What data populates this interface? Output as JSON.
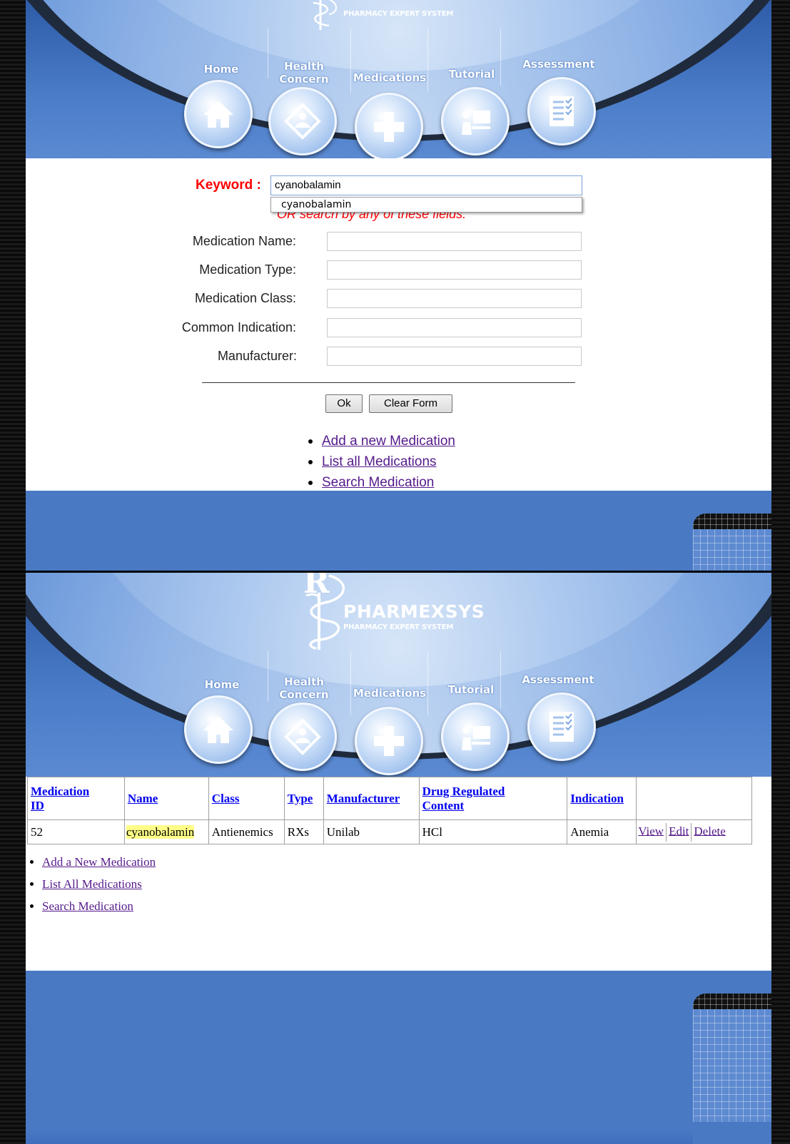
{
  "brand": {
    "name": "PHARMEXSYS",
    "subtitle": "PHARMACY EXPERT SYSTEM",
    "rx_glyph": "R"
  },
  "nav": {
    "home": "Home",
    "health_concern_line1": "Health",
    "health_concern_line2": "Concern",
    "medications": "Medications",
    "tutorial": "Tutorial",
    "assessment": "Assessment"
  },
  "search_form": {
    "keyword_label": "Keyword :",
    "keyword_value": "cyanobalamin",
    "autocomplete_suggestion": "cyanobalamin",
    "or_text": "OR search by any of these fields:",
    "fields": [
      {
        "label": "Medication Name:",
        "value": ""
      },
      {
        "label": "Medication Type:",
        "value": ""
      },
      {
        "label": "Medication Class:",
        "value": ""
      },
      {
        "label": "Common Indication:",
        "value": ""
      },
      {
        "label": "Manufacturer:",
        "value": ""
      }
    ],
    "ok_button": "Ok",
    "clear_button": "Clear Form",
    "links": [
      "Add a new Medication",
      "List all Medications",
      "Search Medication"
    ]
  },
  "results": {
    "headers": {
      "id_line1": "Medication",
      "id_line2": "ID",
      "name": "Name",
      "class": "Class",
      "type": "Type",
      "manufacturer": "Manufacturer",
      "drc_line1": "Drug Regulated",
      "drc_line2": "Content",
      "indication": "Indication"
    },
    "rows": [
      {
        "id": "52",
        "name": "cyanobalamin",
        "class": "Antienemics",
        "type": "RXs",
        "manufacturer": "Unilab",
        "drug_regulated_content": "HCl",
        "indication": "Anemia",
        "view": "View",
        "edit": "Edit",
        "delete": "Delete"
      }
    ],
    "links": [
      "Add a New Medication",
      "List All Medications",
      "Search Medication"
    ]
  },
  "colors": {
    "accent_blue": "#4a79c4",
    "keyword_red": "#ff0000",
    "link_visited": "#551a8b",
    "link_header": "#0000ee",
    "highlight": "#ffff88"
  },
  "icons": [
    "home-icon",
    "health-concern-icon",
    "medications-icon",
    "tutorial-icon",
    "assessment-icon",
    "caduceus-logo-icon"
  ]
}
